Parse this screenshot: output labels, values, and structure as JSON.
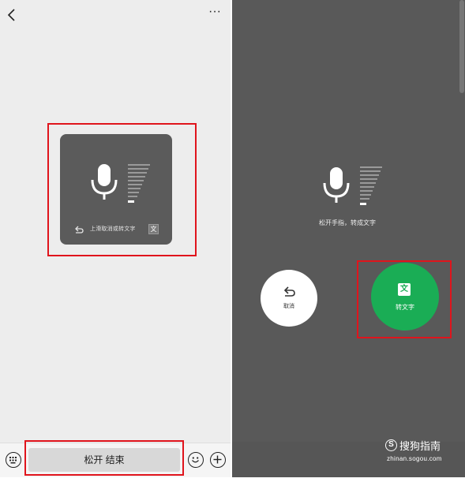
{
  "left": {
    "header": {
      "more_label": "···"
    },
    "voice_card": {
      "hint": "上滑取消或转文字",
      "convert_glyph": "文"
    },
    "bottom_bar": {
      "release_label": "松开 结束"
    }
  },
  "right": {
    "hint": "松开手指，转成文字",
    "cancel_label": "取消",
    "convert_glyph": "文",
    "convert_label": "转文字",
    "watermark": {
      "brand": "搜狗指南",
      "domain": "zhinan.sogou.com"
    }
  },
  "colors": {
    "highlight": "#e0141c",
    "convert_green": "#1aad55",
    "dark_panel": "#595959",
    "card_bg": "#5b5b5b"
  },
  "icons": [
    "back-icon",
    "more-icon",
    "microphone-icon",
    "volume-level-icon",
    "undo-icon",
    "keyboard-icon",
    "emoji-icon",
    "plus-icon",
    "sogou-logo-icon"
  ]
}
